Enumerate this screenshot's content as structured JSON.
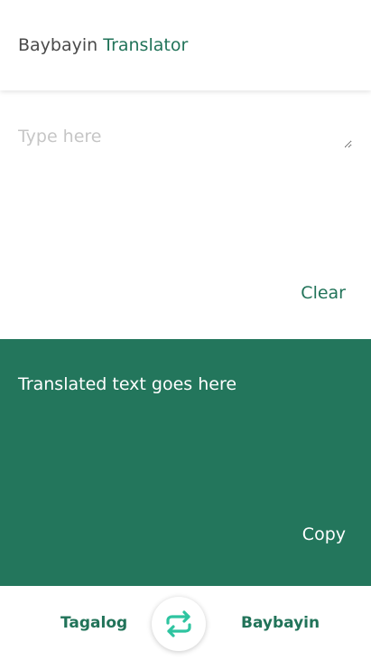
{
  "header": {
    "title_part1": "Baybayin",
    "title_part2": "Translator"
  },
  "input": {
    "value": "",
    "placeholder": "Type here",
    "clear_label": "Clear"
  },
  "output": {
    "text": "Translated text goes here",
    "copy_label": "Copy"
  },
  "bottom_bar": {
    "source_language": "Tagalog",
    "target_language": "Baybayin",
    "swap_icon": "swap-arrows-icon"
  },
  "colors": {
    "accent": "#217359",
    "output_background": "#23765c",
    "swap_icon": "#2ec4a0",
    "title_dark": "#4a4a4a",
    "placeholder": "#c6c6c6"
  }
}
